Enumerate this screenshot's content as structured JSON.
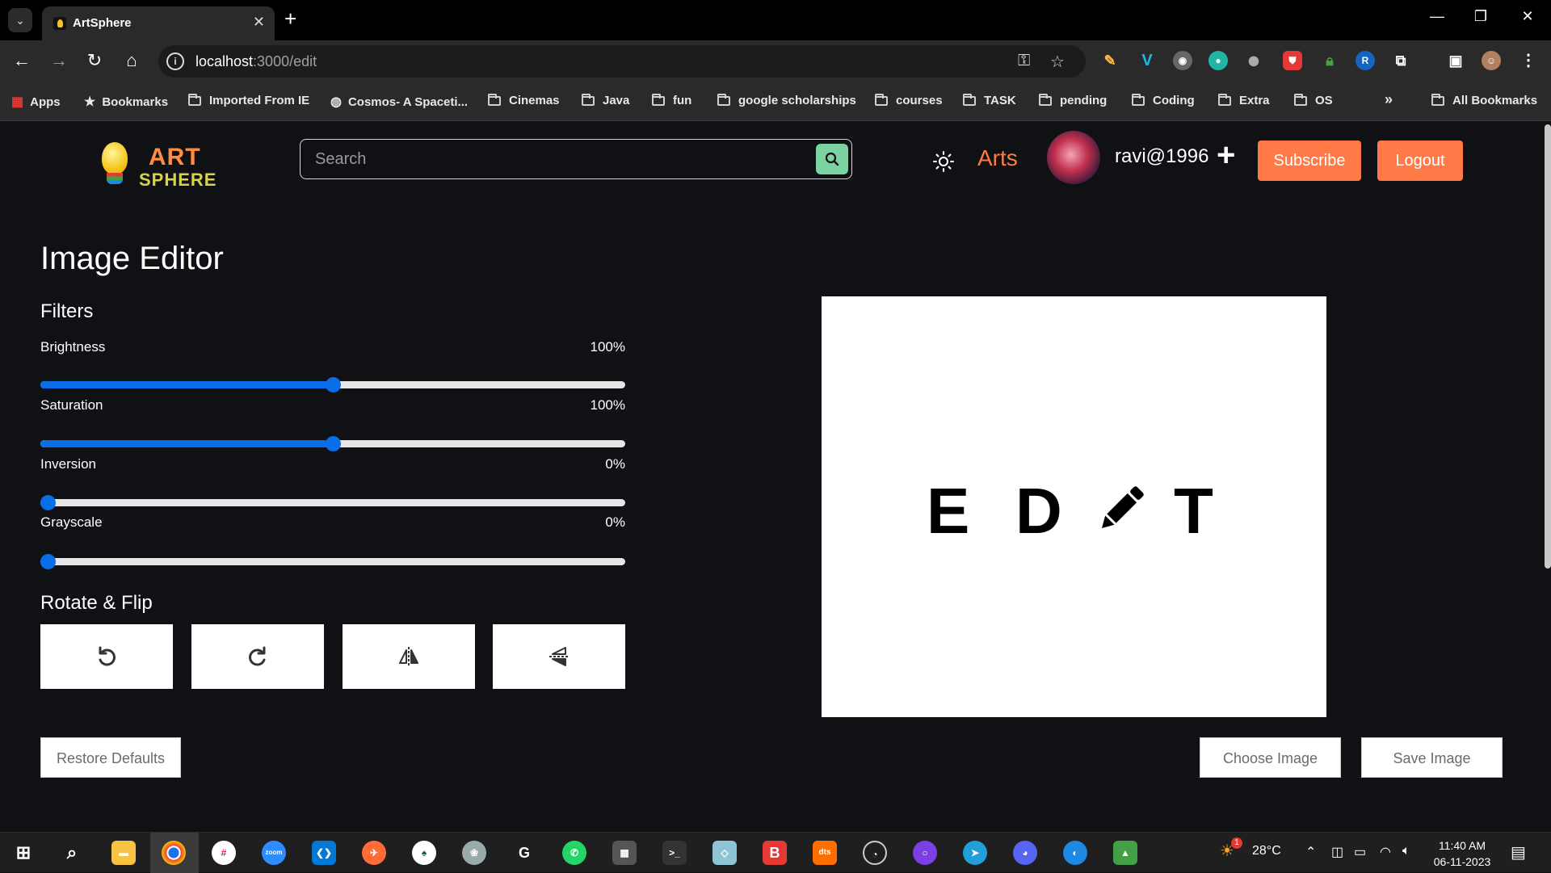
{
  "browser": {
    "tab_title": "ArtSphere",
    "url_host": "localhost",
    "url_path": ":3000/edit",
    "bookmarks": [
      "Apps",
      "Bookmarks",
      "Imported From IE",
      "Cosmos- A Spaceti...",
      "Cinemas",
      "Java",
      "fun",
      "google scholarships",
      "courses",
      "TASK",
      "pending",
      "Coding",
      "Extra",
      "OS"
    ],
    "all_bookmarks": "All Bookmarks",
    "overflow": "»"
  },
  "header": {
    "logo_top": "ART",
    "logo_bottom": "SPHERE",
    "search_placeholder": "Search",
    "arts_link": "Arts",
    "username": "ravi@1996",
    "plus": "+",
    "subscribe": "Subscribe",
    "logout": "Logout"
  },
  "editor": {
    "title": "Image Editor",
    "filters_heading": "Filters",
    "filters": [
      {
        "label": "Brightness",
        "value_text": "100%",
        "fraction": 0.5
      },
      {
        "label": "Saturation",
        "value_text": "100%",
        "fraction": 0.5
      },
      {
        "label": "Inversion",
        "value_text": "0%",
        "fraction": 0.0
      },
      {
        "label": "Grayscale",
        "value_text": "0%",
        "fraction": 0.0
      }
    ],
    "rotate_heading": "Rotate & Flip",
    "rotate_buttons": [
      "rotate-left-icon",
      "rotate-right-icon",
      "flip-horizontal-icon",
      "flip-vertical-icon"
    ],
    "restore": "Restore Defaults",
    "choose": "Choose Image",
    "save": "Save Image",
    "preview_letters": [
      "E",
      "D",
      "T"
    ]
  },
  "taskbar": {
    "weather": "28°C",
    "time": "11:40 AM",
    "date": "06-11-2023",
    "weather_badge": "1"
  },
  "colors": {
    "accent_orange": "#ff7a47",
    "slider_blue": "#0a6ee8",
    "search_green": "#7bd3a1",
    "page_bg": "#0f1115"
  }
}
